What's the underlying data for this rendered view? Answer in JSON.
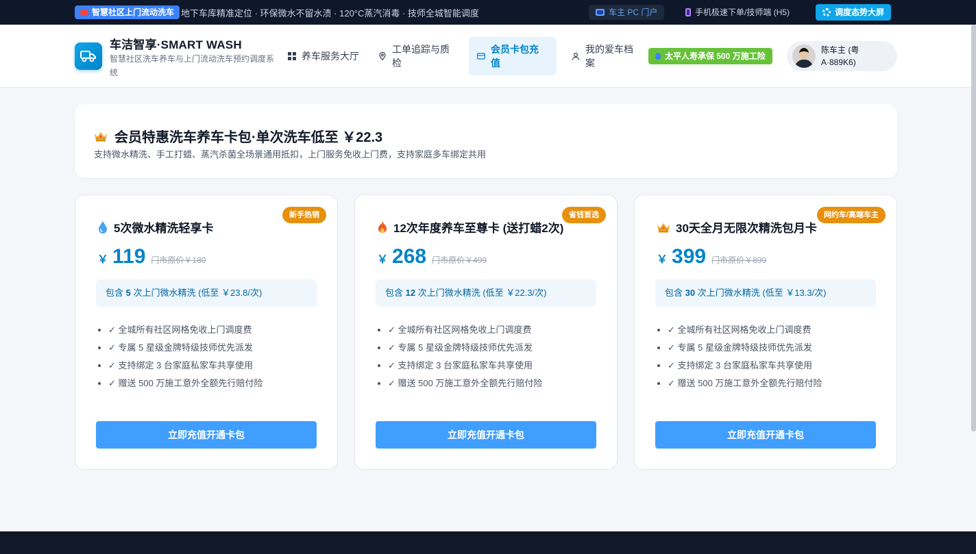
{
  "topbar": {
    "tag": "智慧社区上门流动洗车",
    "marquee": "地下车库精准定位 · 环保微水不留水渍 · 120°C蒸汽消毒 · 技师全城智能调度",
    "portal": "车主 PC 门户",
    "h5": "手机极速下单/技师端 (H5)",
    "dispatch": "调度态势大屏"
  },
  "header": {
    "brand_title": "车洁智享·SMART WASH",
    "brand_subtitle": "智慧社区洗车养车与上门流动洗车预约调度系统",
    "nav": [
      {
        "label": "养车服务大厅",
        "icon": "grid-icon",
        "active": false
      },
      {
        "label": "工单追踪与质检",
        "icon": "location-pin-icon",
        "active": false
      },
      {
        "label": "会员卡包充值",
        "icon": "card-icon",
        "active": true
      },
      {
        "label": "我的爱车档案",
        "icon": "user-icon",
        "active": false
      }
    ],
    "insurance": "太平人寿承保 500 万施工险",
    "user": "陈车主 (粤A·889K6)"
  },
  "hero": {
    "title": "会员特惠洗车养车卡包·单次洗车低至 ￥22.3",
    "desc": "支持微水精洗、手工打蜡、蒸汽杀菌全场景通用抵扣，上门服务免收上门费，支持家庭多车绑定共用"
  },
  "plans": [
    {
      "badge": "新手热销",
      "icon": "water-drop-icon",
      "title": "5次微水精洗轻享卡",
      "currency": "￥",
      "price": "119",
      "original": "门市原价￥180",
      "incl_pre": "包含 ",
      "incl_count": "5",
      "incl_post": " 次上门微水精洗 (低至 ￥23.8/次)",
      "features": [
        "✓ 全城所有社区网格免收上门调度费",
        "✓ 专属 5 星级金牌特级技师优先派发",
        "✓ 支持绑定 3 台家庭私家车共享使用",
        "✓ 赠送 500 万施工意外全额先行赔付险"
      ],
      "button": "立即充值开通卡包"
    },
    {
      "badge": "省钱首选",
      "icon": "fire-icon",
      "title": "12次年度养车至尊卡 (送打蜡2次)",
      "currency": "￥",
      "price": "268",
      "original": "门市原价￥499",
      "incl_pre": "包含 ",
      "incl_count": "12",
      "incl_post": " 次上门微水精洗 (低至 ￥22.3/次)",
      "features": [
        "✓ 全城所有社区网格免收上门调度费",
        "✓ 专属 5 星级金牌特级技师优先派发",
        "✓ 支持绑定 3 台家庭私家车共享使用",
        "✓ 赠送 500 万施工意外全额先行赔付险"
      ],
      "button": "立即充值开通卡包"
    },
    {
      "badge": "网约车/高端车主",
      "icon": "crown-icon",
      "title": "30天全月无限次精洗包月卡",
      "currency": "￥",
      "price": "399",
      "original": "门市原价￥899",
      "incl_pre": "包含 ",
      "incl_count": "30",
      "incl_post": " 次上门微水精洗 (低至 ￥13.3/次)",
      "features": [
        "✓ 全城所有社区网格免收上门调度费",
        "✓ 专属 5 星级金牌特级技师优先派发",
        "✓ 支持绑定 3 台家庭私家车共享使用",
        "✓ 赠送 500 万施工意外全额先行赔付险"
      ],
      "button": "立即充值开通卡包"
    }
  ],
  "colors": {
    "accent": "#0284c7",
    "button": "#409eff",
    "badge": "#e6900d",
    "topbar": "#0f172a"
  }
}
